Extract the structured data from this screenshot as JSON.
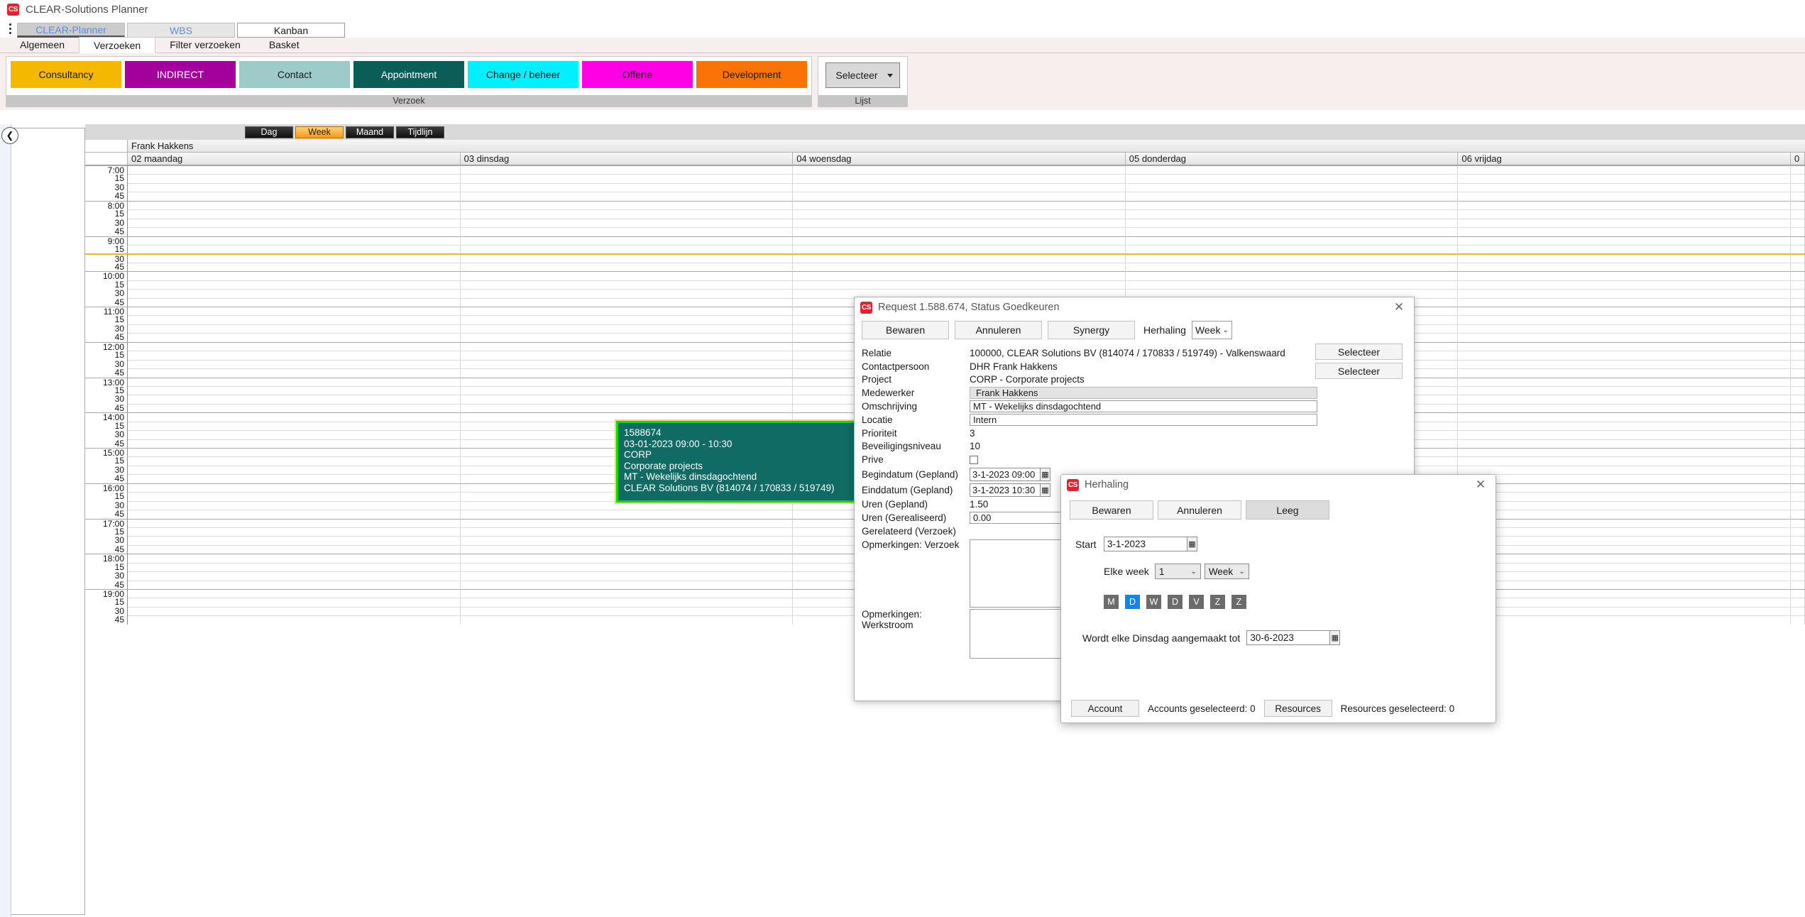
{
  "app": {
    "title": "CLEAR-Solutions Planner",
    "logo_text": "CS"
  },
  "module_tabs": [
    {
      "label": "CLEAR-Planner",
      "state": "selected"
    },
    {
      "label": "WBS",
      "state": "normal"
    },
    {
      "label": "Kanban",
      "state": "plain"
    }
  ],
  "ribbon_tabs": [
    {
      "label": "Algemeen",
      "selected": false
    },
    {
      "label": "Verzoeken",
      "selected": true
    },
    {
      "label": "Filter verzoeken",
      "selected": false
    },
    {
      "label": "Basket",
      "selected": false
    }
  ],
  "ribbon": {
    "verzoek_group": {
      "caption": "Verzoek",
      "buttons": [
        {
          "label": "Consultancy",
          "bg": "#f5b800",
          "fg": "#1a1a1a"
        },
        {
          "label": "INDIRECT",
          "bg": "#a3009c",
          "fg": "#ffffff"
        },
        {
          "label": "Contact",
          "bg": "#9dcbc9",
          "fg": "#1a1a1a"
        },
        {
          "label": "Appointment",
          "bg": "#0a5e57",
          "fg": "#ffffff"
        },
        {
          "label": "Change / beheer",
          "bg": "#00f0ff",
          "fg": "#1a1a1a"
        },
        {
          "label": "Offerte",
          "bg": "#ff00e4",
          "fg": "#1a1a1a"
        },
        {
          "label": "Development",
          "bg": "#f97306",
          "fg": "#1a1a1a"
        }
      ]
    },
    "lijst_group": {
      "caption": "Lijst",
      "select_label": "Selecteer"
    }
  },
  "calendar": {
    "view_buttons": [
      {
        "label": "Dag",
        "selected": false
      },
      {
        "label": "Week",
        "selected": true
      },
      {
        "label": "Maand",
        "selected": false
      },
      {
        "label": "Tijdlijn",
        "selected": false
      }
    ],
    "resource": "Frank Hakkens",
    "days": [
      "02 maandag",
      "03 dinsdag",
      "04 woensdag",
      "05 donderdag",
      "06 vrijdag",
      "0"
    ],
    "hours": [
      "7:00",
      "8:00",
      "9:00",
      "10:00",
      "11:00",
      "12:00",
      "13:00",
      "14:00",
      "15:00",
      "16:00",
      "17:00",
      "18:00",
      "19:00"
    ],
    "quarters": [
      "15",
      "30",
      "45"
    ],
    "current_time_hour": "9:00",
    "current_time_quarter": "30",
    "appointment": {
      "id": "1588674",
      "time": "03-01-2023 09:00 - 10:30",
      "code": "CORP",
      "project": "Corporate projects",
      "description": "MT - Wekelijks dinsdagochtend",
      "relation": "CLEAR Solutions BV (814074 / 170833 / 519749)",
      "border_color": "#00e400",
      "bg_color": "#0f6b63"
    }
  },
  "request_dialog": {
    "title": "Request 1.588.674, Status Goedkeuren",
    "close_glyph": "✕",
    "toolbar": {
      "save": "Bewaren",
      "cancel": "Annuleren",
      "synergy": "Synergy",
      "recurrence_label": "Herhaling",
      "recurrence_value": "Week"
    },
    "fields": [
      {
        "label": "Relatie",
        "value": "100000, CLEAR Solutions BV (814074 / 170833 / 519749) - Valkenswaard",
        "kind": "text"
      },
      {
        "label": "Contactpersoon",
        "value": "DHR Frank Hakkens",
        "kind": "text"
      },
      {
        "label": "Project",
        "value": "CORP - Corporate projects",
        "kind": "text"
      },
      {
        "label": "Medewerker",
        "value": "Frank Hakkens",
        "kind": "input-gray"
      },
      {
        "label": "Omschrijving",
        "value": "MT - Wekelijks dinsdagochtend",
        "kind": "input"
      },
      {
        "label": "Locatie",
        "value": "Intern",
        "kind": "input"
      },
      {
        "label": "Prioriteit",
        "value": "3",
        "kind": "text"
      },
      {
        "label": "Beveiligingsniveau",
        "value": "10",
        "kind": "text"
      },
      {
        "label": "Prive",
        "value": "",
        "kind": "checkbox"
      },
      {
        "label": "Begindatum (Gepland)",
        "value": "3-1-2023 09:00",
        "kind": "date"
      },
      {
        "label": "Einddatum (Gepland)",
        "value": "3-1-2023 10:30",
        "kind": "date"
      },
      {
        "label": "Uren (Gepland)",
        "value": "1.50",
        "kind": "text"
      },
      {
        "label": "Uren (Gerealiseerd)",
        "value": "0.00",
        "kind": "input"
      },
      {
        "label": "Gerelateerd (Verzoek)",
        "value": "",
        "kind": "text"
      },
      {
        "label": "Opmerkingen: Verzoek",
        "value": "",
        "kind": "textarea"
      },
      {
        "label": "Opmerkingen: Werkstroom",
        "value": "",
        "kind": "textarea"
      }
    ],
    "side_buttons": [
      {
        "label": "Selecteer"
      },
      {
        "label": "Selecteer"
      }
    ]
  },
  "recurrence_dialog": {
    "title": "Herhaling",
    "close_glyph": "✕",
    "toolbar": {
      "save": "Bewaren",
      "cancel": "Annuleren",
      "clear": "Leeg"
    },
    "start_label": "Start",
    "start_value": "3-1-2023",
    "every_label": "Elke week",
    "every_value": "1",
    "period_value": "Week",
    "day_toggles": [
      {
        "label": "M",
        "on": false
      },
      {
        "label": "D",
        "on": true
      },
      {
        "label": "W",
        "on": false
      },
      {
        "label": "D",
        "on": false
      },
      {
        "label": "V",
        "on": false
      },
      {
        "label": "Z",
        "on": false
      },
      {
        "label": "Z",
        "on": false
      }
    ],
    "until_label": "Wordt elke Dinsdag aangemaakt tot",
    "until_value": "30-6-2023",
    "footer": {
      "account_button": "Account",
      "accounts_count": "Accounts geselecteerd: 0",
      "resources_button": "Resources",
      "resources_count": "Resources geselecteerd: 0"
    }
  },
  "colors": {
    "accent_orange": "#f5b721",
    "selected_blue": "#1683e8",
    "brand_red": "#e0232e"
  }
}
